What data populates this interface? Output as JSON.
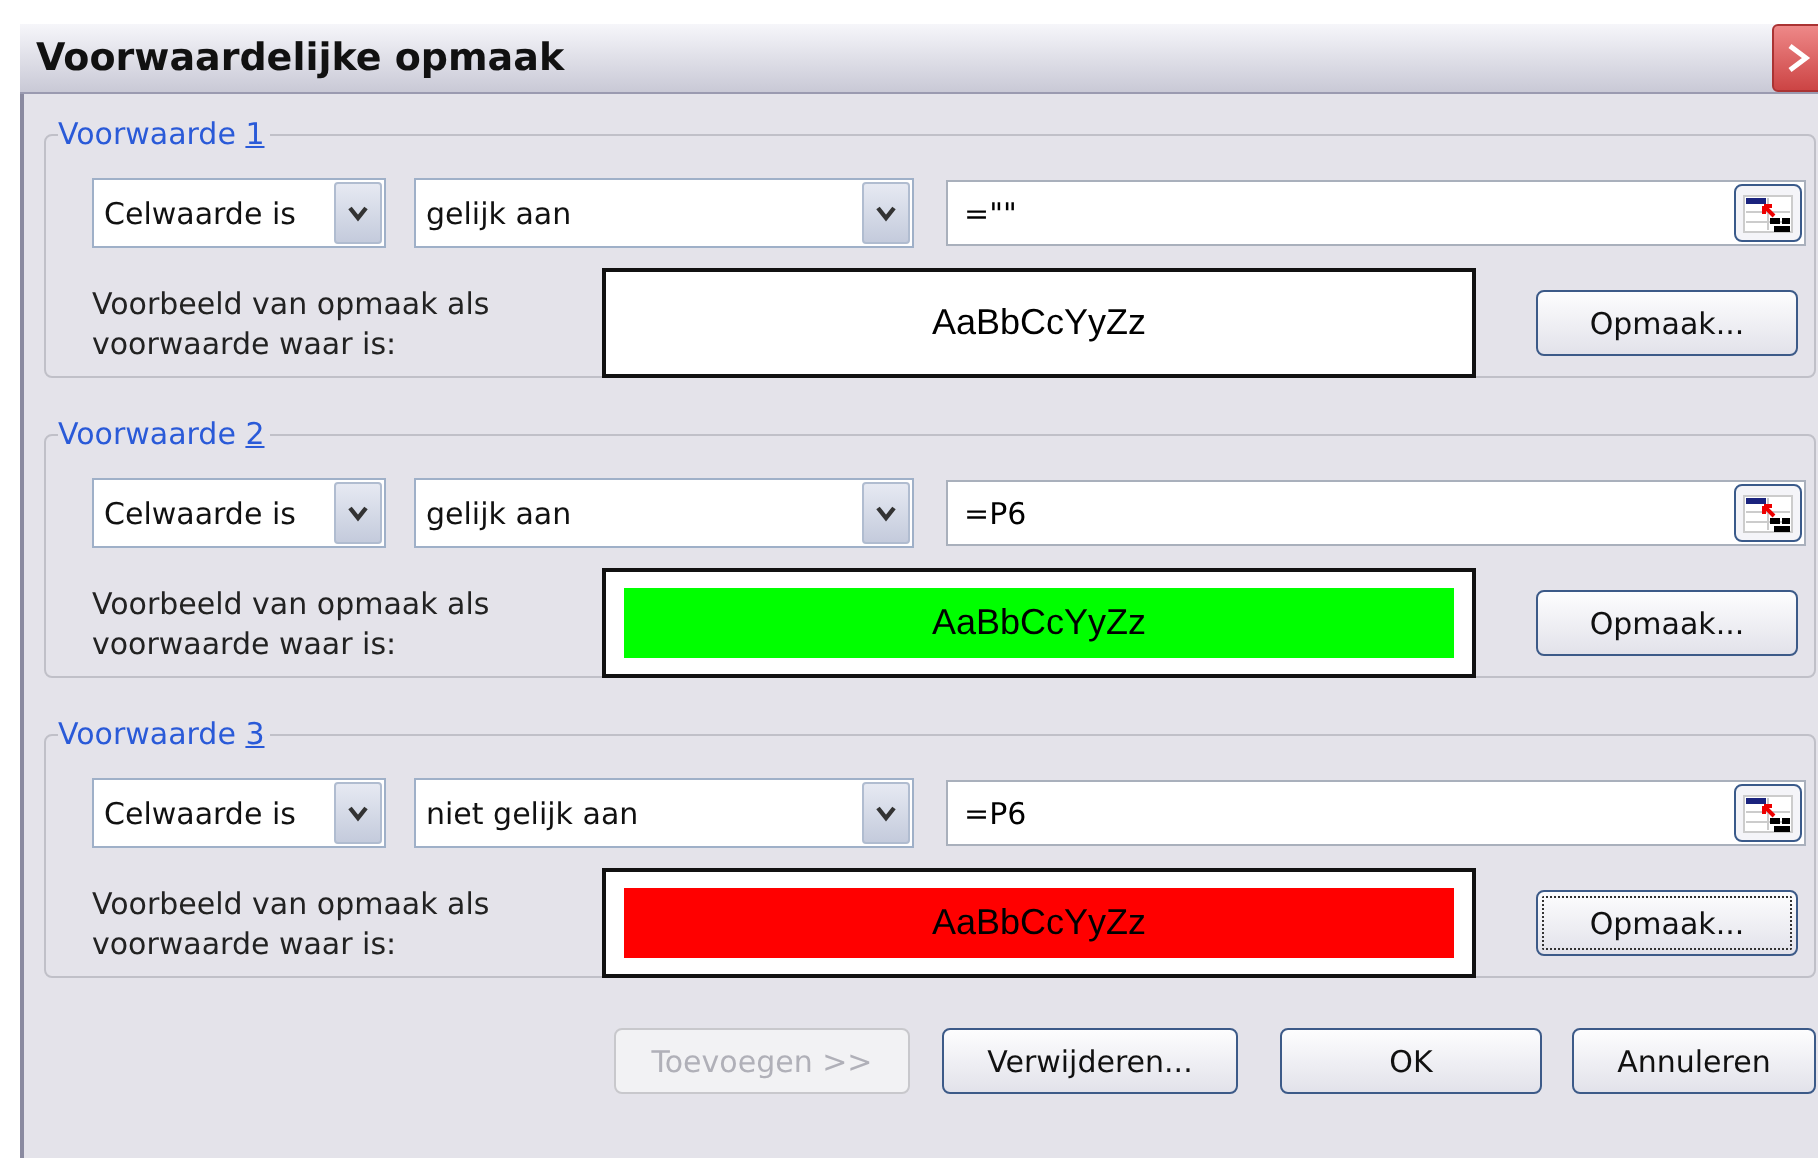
{
  "window": {
    "title": "Voorwaardelijke opmaak"
  },
  "conditions": [
    {
      "title": "Voorwaarde",
      "number": "1",
      "type": "Celwaarde is",
      "operator": "gelijk aan",
      "value": "=\"\"",
      "preview_label": "Voorbeeld van opmaak als voorwaarde waar is:",
      "preview_text": "AaBbCcYyZz",
      "color": "#ffffff",
      "format_button": {
        "label": "Opmaak...",
        "focused": false
      }
    },
    {
      "title": "Voorwaarde",
      "number": "2",
      "type": "Celwaarde is",
      "operator": "gelijk aan",
      "value": "=P6",
      "preview_label": "Voorbeeld van opmaak als voorwaarde waar is:",
      "preview_text": "AaBbCcYyZz",
      "color": "#00ff00",
      "format_button": {
        "label": "Opmaak...",
        "focused": false
      }
    },
    {
      "title": "Voorwaarde",
      "number": "3",
      "type": "Celwaarde is",
      "operator": "niet gelijk aan",
      "value": "=P6",
      "preview_label": "Voorbeeld van opmaak als voorwaarde waar is:",
      "preview_text": "AaBbCcYyZz",
      "color": "#ff0000",
      "format_button": {
        "label": "Opmaak...",
        "focused": true
      }
    }
  ],
  "buttons": [
    {
      "label": "Toevoegen >>",
      "disabled": true
    },
    {
      "label": "Verwijderen...",
      "disabled": false
    },
    {
      "label": "OK",
      "disabled": false
    },
    {
      "label": "Annuleren",
      "disabled": false
    }
  ]
}
